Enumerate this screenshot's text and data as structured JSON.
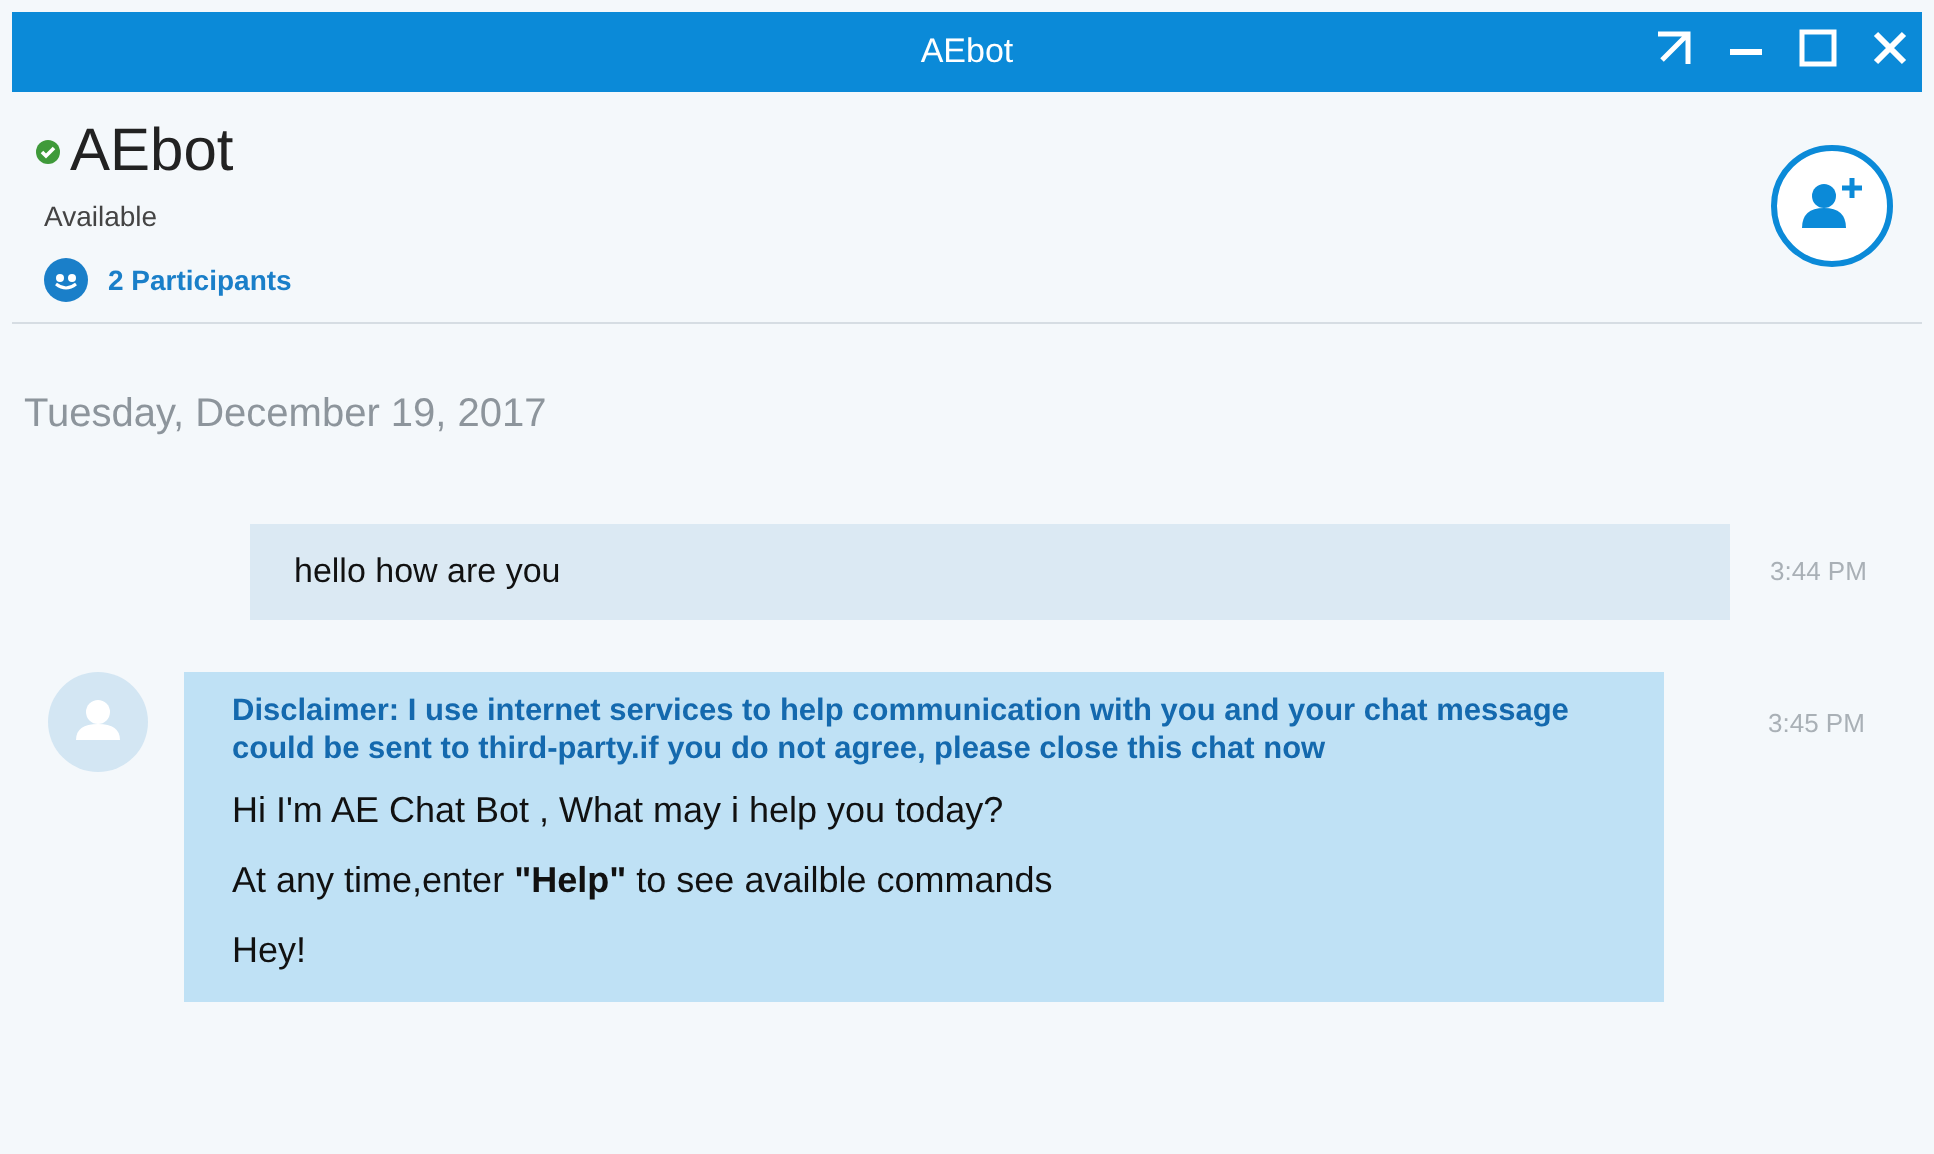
{
  "window": {
    "title": "AEbot"
  },
  "contact": {
    "name": "AEbot",
    "status": "Available",
    "available": true,
    "participants": "2 Participants"
  },
  "date": "Tuesday, December 19, 2017",
  "messages": [
    {
      "kind": "sent",
      "lines": [
        "hello how are you"
      ],
      "time": "3:44 PM"
    },
    {
      "kind": "received",
      "disclaimer": "Disclaimer: I use internet services to help communication with you and your chat message could be sent to third-party.if you do not agree, please close this chat now",
      "lines": [
        "Hi I'm AE Chat Bot , What may i help you today?",
        "At any time,enter **\"Help\"** to see availble commands",
        "Hey!"
      ],
      "time": "3:45 PM"
    }
  ]
}
